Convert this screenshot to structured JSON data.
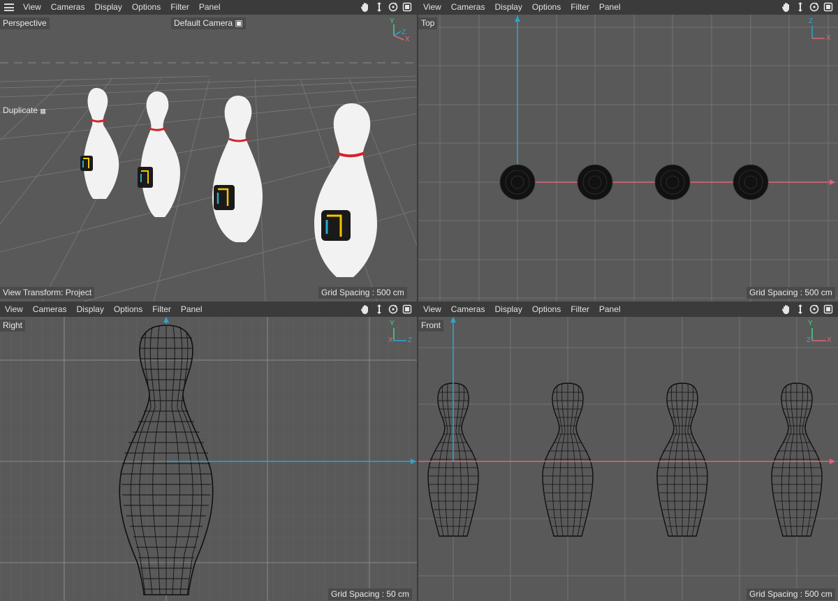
{
  "menu": {
    "view": "View",
    "cameras": "Cameras",
    "display": "Display",
    "options": "Options",
    "filter": "Filter",
    "panel": "Panel"
  },
  "icons": {
    "menu": "hamburger-icon",
    "pan": "hand-icon",
    "move": "move-arrows-icon",
    "rotate": "rotate-icon",
    "maximize": "maximize-icon"
  },
  "viewports": {
    "perspective": {
      "name": "Perspective",
      "camera": "Default Camera",
      "duplicate": "Duplicate",
      "view_transform": "View Transform: Project",
      "grid_spacing": "Grid Spacing : 500 cm",
      "axis": {
        "y": "Y",
        "z": "Z",
        "x": "X"
      }
    },
    "top": {
      "name": "Top",
      "grid_spacing": "Grid Spacing : 500 cm",
      "axis": {
        "z": "Z",
        "x": "X"
      }
    },
    "right": {
      "name": "Right",
      "grid_spacing": "Grid Spacing : 50 cm",
      "axis": {
        "y": "Y",
        "x": "X",
        "z": "Z"
      }
    },
    "front": {
      "name": "Front",
      "grid_spacing": "Grid Spacing : 500 cm",
      "axis": {
        "y": "Y",
        "z": "Z",
        "x": "X"
      }
    }
  },
  "colors": {
    "viewport_bg": "#595959",
    "menubar_bg": "#3b3b3b",
    "grid": "#7a7a7a",
    "axis_blue": "#29a9cf",
    "axis_red": "#e0667a",
    "axis_green": "#4bd18a",
    "pin_white": "#f2f2f2",
    "stripe_red": "#d2232a"
  }
}
